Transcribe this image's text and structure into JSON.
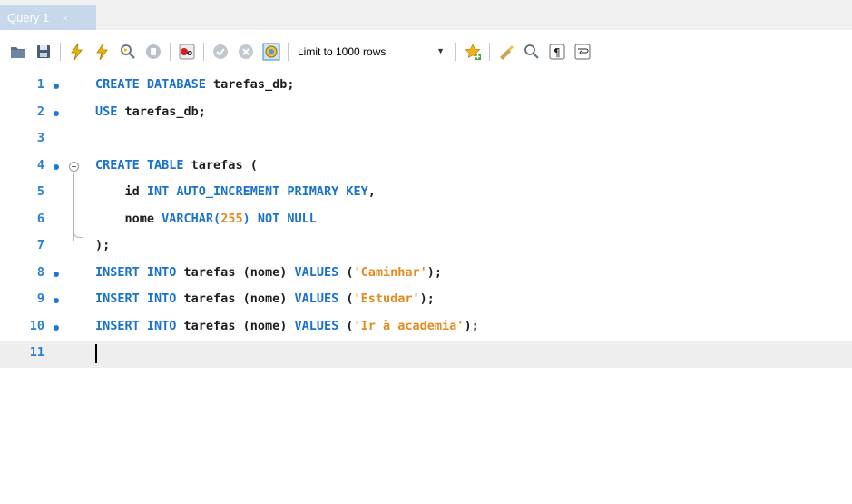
{
  "tab": {
    "title": "Query 1",
    "close": "×"
  },
  "toolbar": {
    "icons": [
      "open-folder-icon",
      "save-icon",
      "execute-icon",
      "execute-current-icon",
      "explain-icon",
      "stop-icon",
      "toggle-stop-on-error-icon",
      "commit-icon",
      "rollback-icon",
      "autocommit-icon"
    ],
    "limit_label": "Limit to 1000 rows",
    "right_icons": [
      "add-snippet-icon",
      "beautify-icon",
      "find-icon",
      "invisible-chars-icon",
      "word-wrap-icon"
    ]
  },
  "editor": {
    "lines": [
      {
        "n": "1",
        "dot": true,
        "tokens": [
          {
            "t": "kw",
            "v": "CREATE DATABASE "
          },
          {
            "t": "id",
            "v": "tarefas_db;"
          }
        ]
      },
      {
        "n": "2",
        "dot": true,
        "tokens": [
          {
            "t": "kw",
            "v": "USE "
          },
          {
            "t": "id",
            "v": "tarefas_db;"
          }
        ]
      },
      {
        "n": "3",
        "dot": false,
        "tokens": []
      },
      {
        "n": "4",
        "dot": true,
        "fold": true,
        "tokens": [
          {
            "t": "kw",
            "v": "CREATE TABLE "
          },
          {
            "t": "id",
            "v": "tarefas ("
          }
        ]
      },
      {
        "n": "5",
        "dot": false,
        "tokens": [
          {
            "t": "id",
            "v": "    id "
          },
          {
            "t": "kw",
            "v": "INT AUTO_INCREMENT PRIMARY KEY"
          },
          {
            "t": "id",
            "v": ","
          }
        ]
      },
      {
        "n": "6",
        "dot": false,
        "tokens": [
          {
            "t": "id",
            "v": "    nome "
          },
          {
            "t": "kw",
            "v": "VARCHAR("
          },
          {
            "t": "num",
            "v": "255"
          },
          {
            "t": "kw",
            "v": ") NOT NULL"
          }
        ]
      },
      {
        "n": "7",
        "dot": false,
        "tokens": [
          {
            "t": "id",
            "v": ");"
          }
        ]
      },
      {
        "n": "8",
        "dot": true,
        "tokens": [
          {
            "t": "kw",
            "v": "INSERT INTO "
          },
          {
            "t": "id",
            "v": "tarefas (nome) "
          },
          {
            "t": "kw",
            "v": "VALUES "
          },
          {
            "t": "id",
            "v": "("
          },
          {
            "t": "str",
            "v": "'Caminhar'"
          },
          {
            "t": "id",
            "v": ");"
          }
        ]
      },
      {
        "n": "9",
        "dot": true,
        "tokens": [
          {
            "t": "kw",
            "v": "INSERT INTO "
          },
          {
            "t": "id",
            "v": "tarefas (nome) "
          },
          {
            "t": "kw",
            "v": "VALUES "
          },
          {
            "t": "id",
            "v": "("
          },
          {
            "t": "str",
            "v": "'Estudar'"
          },
          {
            "t": "id",
            "v": ");"
          }
        ]
      },
      {
        "n": "10",
        "dot": true,
        "tokens": [
          {
            "t": "kw",
            "v": "INSERT INTO "
          },
          {
            "t": "id",
            "v": "tarefas (nome) "
          },
          {
            "t": "kw",
            "v": "VALUES "
          },
          {
            "t": "id",
            "v": "("
          },
          {
            "t": "str",
            "v": "'Ir à academia'"
          },
          {
            "t": "id",
            "v": ");"
          }
        ]
      },
      {
        "n": "11",
        "dot": false,
        "current": true,
        "tokens": []
      }
    ]
  }
}
